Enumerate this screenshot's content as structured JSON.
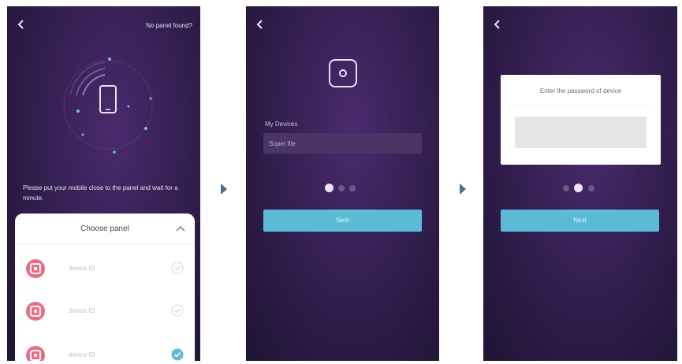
{
  "screen1": {
    "link": "No panel found?",
    "hint": "Please put your mobile close to the panel and wait for a minute.",
    "sheet": {
      "title": "Choose panel",
      "items": [
        {
          "label": "device ID",
          "state": "unchecked"
        },
        {
          "label": "device ID",
          "state": "unchecked"
        },
        {
          "label": "device ID",
          "state": "checked"
        }
      ]
    }
  },
  "screen2": {
    "field_label": "My Devices",
    "field_value": "Super file",
    "button": "Next"
  },
  "screen3": {
    "card_title": "Enter the password of device",
    "button": "Next"
  },
  "colors": {
    "background_dark": "#2a1a44",
    "accent_button": "#5bbbd6",
    "panel_icon": "#ee6b86",
    "check_selected": "#5bbbd6"
  },
  "icons": {
    "back": "back-arrow-icon",
    "step_arrow": "triangle-right-icon",
    "scan": "phone-scanning-icon",
    "device": "device-square-icon",
    "chevron": "chevron-up-icon",
    "check": "check-circle-icon"
  },
  "progress": {
    "screen2_active_step": 1,
    "screen3_active_step": 2,
    "total_steps": 3
  }
}
